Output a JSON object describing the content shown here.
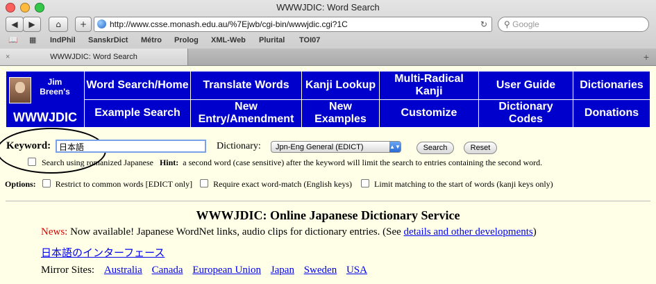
{
  "window": {
    "title": "WWWJDIC: Word Search",
    "url": "http://www.csse.monash.edu.au/%7Ejwb/cgi-bin/wwwjdic.cgi?1C",
    "search_placeholder": "Google",
    "bookmarks": [
      "IndPhil",
      "SanskrDict",
      "Métro",
      "Prolog",
      "XML-Web",
      "Plurital",
      "TOI07"
    ],
    "tab_title": "WWWJDIC: Word Search"
  },
  "nav": {
    "logo_top": "Jim Breen's",
    "logo_bottom": "WWWJDIC",
    "row1": [
      "Word Search/Home",
      "Translate Words",
      "Kanji Lookup",
      "Multi-Radical Kanji",
      "User Guide",
      "Dictionaries"
    ],
    "row2": [
      "Example Search",
      "New Entry/Amendment",
      "New Examples",
      "Customize",
      "Dictionary Codes",
      "Donations"
    ]
  },
  "form": {
    "keyword_label": "Keyword:",
    "keyword_value": "日本語",
    "dictionary_label": "Dictionary:",
    "dictionary_selected": "Jpn-Eng General (EDICT)",
    "search_button": "Search",
    "reset_button": "Reset",
    "romanized_label": "Search using romanized Japanese",
    "hint_label": "Hint:",
    "hint_text": "a second word (case sensitive) after the keyword will limit the search to entries containing the second word.",
    "options_label": "Options:",
    "option1": "Restrict to common words [EDICT only]",
    "option2": "Require exact word-match (English keys)",
    "option3": "Limit matching to the start of words (kanji keys only)"
  },
  "content": {
    "heading": "WWWJDIC: Online Japanese Dictionary Service",
    "news_label": "News:",
    "news_text": " Now available! Japanese WordNet links, audio clips for dictionary entries. (See ",
    "news_link": "details and other developments",
    "news_end": ")",
    "japanese_link": "日本語のインターフェース",
    "mirror_label": "Mirror Sites:",
    "mirrors": [
      "Australia",
      "Canada",
      "European Union",
      "Japan",
      "Sweden",
      "USA"
    ]
  },
  "colors": {
    "nav_bg": "#0000cc",
    "page_bg": "#ffffe8",
    "news_red": "#dd0000"
  }
}
